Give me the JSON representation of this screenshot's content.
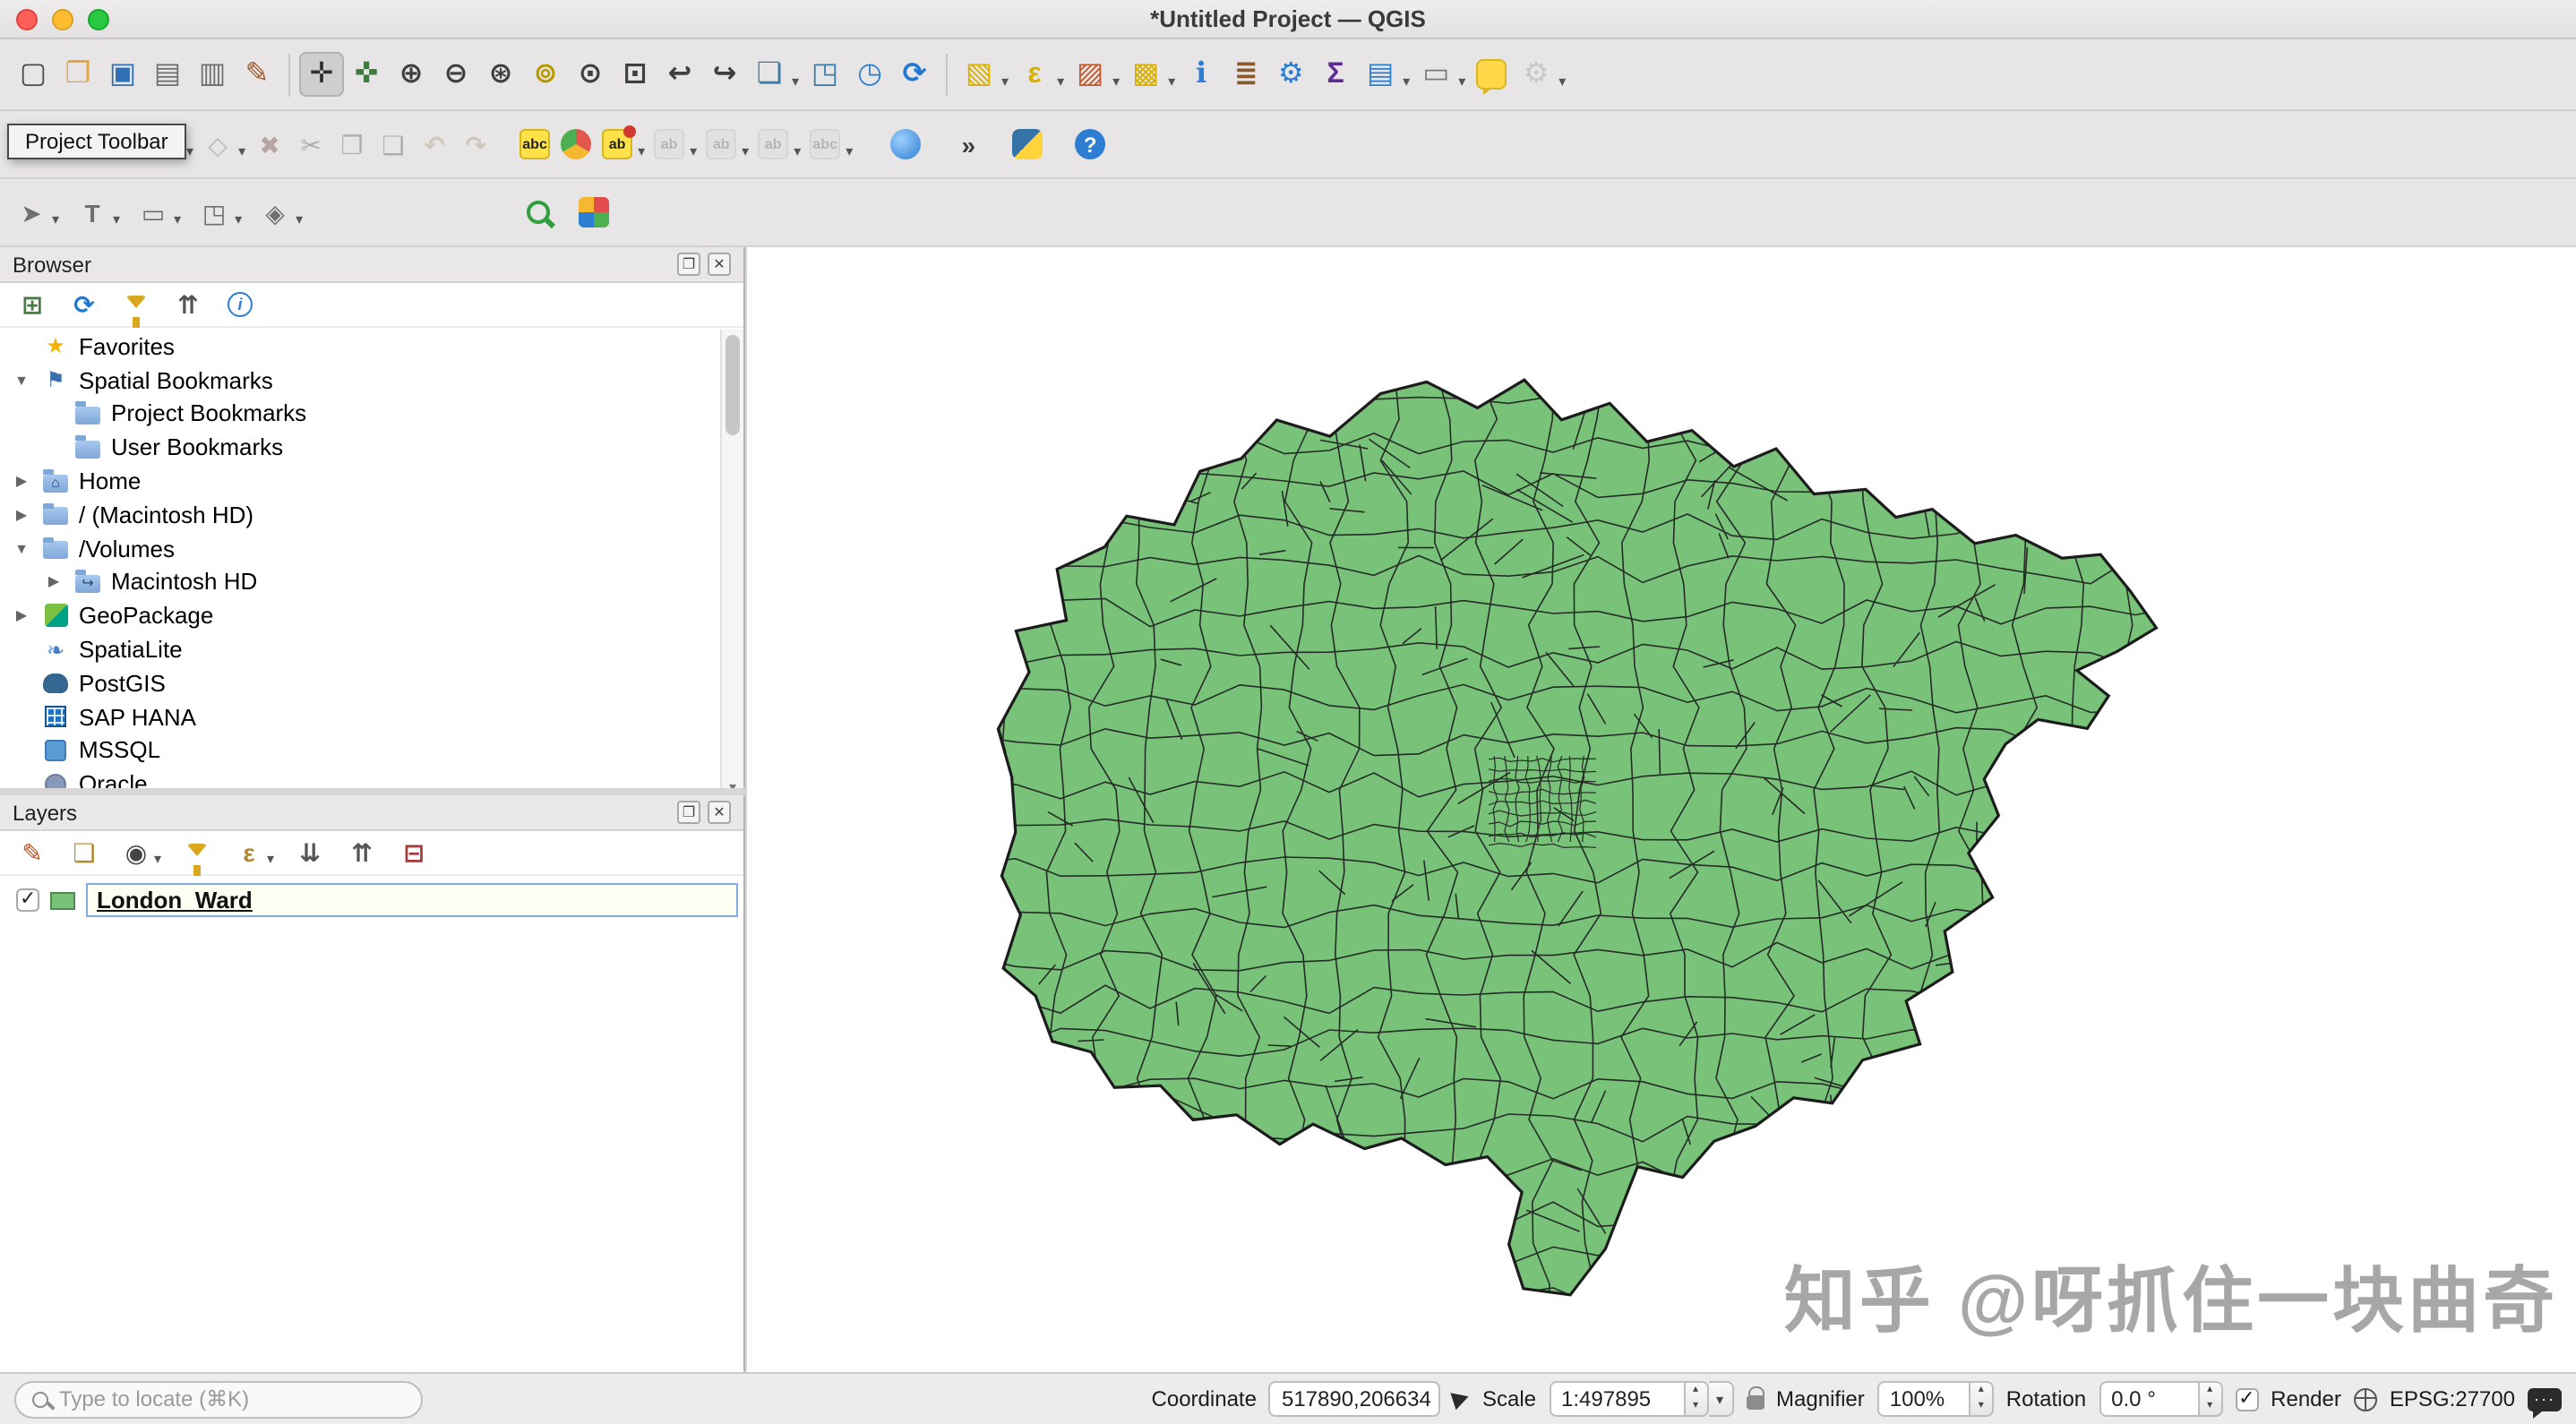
{
  "window": {
    "title": "*Untitled Project — QGIS"
  },
  "tooltip": {
    "text": "Project Toolbar"
  },
  "panel_buttons": {
    "float": "❐",
    "close": "✕"
  },
  "toolbar_row1": [
    {
      "name": "new-project",
      "glyph": "▢",
      "color": "#4a4a4a"
    },
    {
      "name": "open-project",
      "glyph": "❐",
      "color": "#e8a33d"
    },
    {
      "name": "save-project",
      "glyph": "▣",
      "color": "#2f6fb3"
    },
    {
      "name": "new-print-layout",
      "glyph": "▤",
      "color": "#6f6f6f"
    },
    {
      "name": "show-layout-manager",
      "glyph": "▥",
      "color": "#6f6f6f"
    },
    {
      "name": "style-manager",
      "glyph": "✎",
      "color": "#a05a2c"
    },
    {
      "sep": true
    },
    {
      "name": "pan-map",
      "glyph": "✛",
      "color": "#2f2f2f",
      "pressed": true
    },
    {
      "name": "pan-to-selection",
      "glyph": "✜",
      "color": "#3d7a3d"
    },
    {
      "name": "zoom-in",
      "glyph": "⊕",
      "color": "#3f3f3f"
    },
    {
      "name": "zoom-out",
      "glyph": "⊖",
      "color": "#3f3f3f"
    },
    {
      "name": "zoom-full-extent",
      "glyph": "⊛",
      "color": "#3f3f3f"
    },
    {
      "name": "zoom-to-selection",
      "glyph": "⊚",
      "color": "#b59a00"
    },
    {
      "name": "zoom-to-layer",
      "glyph": "⊙",
      "color": "#3f3f3f"
    },
    {
      "name": "zoom-native",
      "glyph": "⊡",
      "color": "#3f3f3f"
    },
    {
      "name": "zoom-last",
      "glyph": "↩",
      "color": "#3f3f3f"
    },
    {
      "name": "zoom-next",
      "glyph": "↪",
      "color": "#3f3f3f"
    },
    {
      "name": "new-map-view",
      "glyph": "❏",
      "color": "#3a7ca5",
      "dropdown": true
    },
    {
      "name": "new-3d-map-view",
      "glyph": "◳",
      "color": "#3a7ca5"
    },
    {
      "name": "temporal-controller",
      "glyph": "◷",
      "color": "#2d7dd2"
    },
    {
      "name": "refresh-map",
      "glyph": "⟳",
      "color": "#1f78d1"
    },
    {
      "sep": true
    },
    {
      "name": "select-features",
      "glyph": "▧",
      "color": "#d8b000",
      "dropdown": true
    },
    {
      "name": "select-by-expression",
      "glyph": "ε",
      "color": "#d8b000",
      "dropdown": true
    },
    {
      "name": "deselect-features",
      "glyph": "▨",
      "color": "#c2572a",
      "dropdown": true
    },
    {
      "name": "select-by-value",
      "glyph": "▩",
      "color": "#d8b000",
      "dropdown": true
    },
    {
      "name": "identify-features",
      "glyph": "ℹ",
      "color": "#2d7dd2"
    },
    {
      "name": "field-calculator",
      "glyph": "≣",
      "color": "#8a5a2c"
    },
    {
      "name": "processing-toolbox",
      "glyph": "⚙",
      "color": "#2d7dd2"
    },
    {
      "name": "statistical-summary",
      "glyph": "Σ",
      "color": "#5c2d91"
    },
    {
      "name": "attributes-panel",
      "glyph": "▤",
      "color": "#2d7dd2",
      "dropdown": true
    },
    {
      "name": "measure",
      "glyph": "▭",
      "color": "#7a7a7a",
      "dropdown": true
    },
    {
      "name": "map-tips",
      "cls": "bubble-y"
    },
    {
      "name": "annotation-tools",
      "glyph": "⚙",
      "color": "#9a9a9a",
      "dropdown": true,
      "enabled": false
    }
  ],
  "toolbar_row2": [
    {
      "name": "current-edits",
      "glyph": "✎",
      "color": "#6f6f6f",
      "dropdown": true,
      "enabled": false
    },
    {
      "name": "toggle-editing",
      "glyph": "✏",
      "color": "#b08830",
      "enabled": false
    },
    {
      "name": "save-layer-edits",
      "glyph": "▣",
      "color": "#6f6f6f",
      "enabled": false
    },
    {
      "name": "add-feature",
      "glyph": "◉",
      "color": "#3d7a3d",
      "dropdown": true,
      "enabled": false
    },
    {
      "name": "vertex-tool",
      "glyph": "◇",
      "color": "#6f6f6f",
      "dropdown": true,
      "enabled": false
    },
    {
      "name": "delete-selected",
      "glyph": "✖",
      "color": "#b03030",
      "enabled": false
    },
    {
      "name": "cut-features",
      "glyph": "✂",
      "color": "#555555",
      "enabled": false
    },
    {
      "name": "copy-features",
      "glyph": "❐",
      "color": "#555555",
      "enabled": false
    },
    {
      "name": "paste-features",
      "glyph": "❑",
      "color": "#555555",
      "enabled": false
    },
    {
      "name": "undo",
      "glyph": "↶",
      "color": "#c79a1e",
      "enabled": false
    },
    {
      "name": "redo",
      "glyph": "↷",
      "color": "#c79a1e",
      "enabled": false
    },
    {
      "gap": 10
    },
    {
      "name": "layer-labeling",
      "cls": "abc",
      "text": "abc"
    },
    {
      "name": "layer-diagram",
      "cls": "pie"
    },
    {
      "name": "pin-labels",
      "cls": "abc-red",
      "text": "ab",
      "dropdown": true
    },
    {
      "name": "highlight-pinned-labels",
      "cls": "abc-gray",
      "text": "ab",
      "enabled": false,
      "dropdown": true
    },
    {
      "name": "move-label",
      "cls": "abc-gray",
      "text": "ab",
      "enabled": false,
      "dropdown": true
    },
    {
      "name": "rotate-label",
      "cls": "abc-gray",
      "text": "ab",
      "enabled": false,
      "dropdown": true
    },
    {
      "name": "change-label-properties",
      "cls": "abc-gray",
      "text": "abc",
      "enabled": false,
      "dropdown": true
    },
    {
      "gap": 16
    },
    {
      "name": "metasearch",
      "cls": "globe"
    },
    {
      "gap": 12
    },
    {
      "name": "toolbar-overflow",
      "glyph": "»",
      "color": "#3f3f3f"
    },
    {
      "gap": 10
    },
    {
      "name": "python-console",
      "cls": "python"
    },
    {
      "gap": 12
    },
    {
      "name": "help",
      "cls": "help",
      "text": "?"
    }
  ],
  "toolbar_row3": [
    {
      "name": "move-annotation",
      "glyph": "➤",
      "color": "#6f6f6f",
      "dropdown": true
    },
    {
      "gap": 5
    },
    {
      "name": "text-annotation",
      "glyph": "T",
      "color": "#6f6f6f",
      "dropdown": true
    },
    {
      "gap": 5
    },
    {
      "name": "form-annotation",
      "glyph": "▭",
      "color": "#6f6f6f",
      "dropdown": true
    },
    {
      "gap": 5
    },
    {
      "name": "html-annotation",
      "glyph": "◳",
      "color": "#6f6f6f",
      "dropdown": true
    },
    {
      "gap": 5
    },
    {
      "name": "svg-annotation",
      "glyph": "◈",
      "color": "#6f6f6f",
      "dropdown": true
    },
    {
      "gap": 118
    },
    {
      "name": "geosearch",
      "cls": "mag-green"
    },
    {
      "gap": 8
    },
    {
      "name": "quickmapservices",
      "cls": "qms"
    }
  ],
  "browser": {
    "title": "Browser",
    "toolbar": [
      {
        "name": "add-selected-layers",
        "glyph": "⊞",
        "color": "#4a7a4a"
      },
      {
        "name": "refresh-browser",
        "glyph": "⟳",
        "color": "#1f78d1"
      },
      {
        "name": "filter-browser",
        "cls": "funnel"
      },
      {
        "name": "collapse-all-browser",
        "glyph": "⇈",
        "color": "#555555"
      },
      {
        "name": "properties-widget",
        "cls": "info-circle",
        "text": "i"
      }
    ],
    "items": [
      {
        "label": "Favorites",
        "depth": 0,
        "arrow": null,
        "icon": "star"
      },
      {
        "label": "Spatial Bookmarks",
        "depth": 0,
        "arrow": "down",
        "icon": "bookmark"
      },
      {
        "label": "Project Bookmarks",
        "depth": 1,
        "arrow": null,
        "icon": "folder"
      },
      {
        "label": "User Bookmarks",
        "depth": 1,
        "arrow": null,
        "icon": "folder"
      },
      {
        "label": "Home",
        "depth": 0,
        "arrow": "right",
        "icon": "home"
      },
      {
        "label": "/ (Macintosh HD)",
        "depth": 0,
        "arrow": "right",
        "icon": "folder"
      },
      {
        "label": "/Volumes",
        "depth": 0,
        "arrow": "down",
        "icon": "folder"
      },
      {
        "label": "Macintosh HD",
        "depth": 1,
        "arrow": "right",
        "icon": "folder-link"
      },
      {
        "label": "GeoPackage",
        "depth": 0,
        "arrow": "right",
        "icon": "gpkg"
      },
      {
        "label": "SpatiaLite",
        "depth": 0,
        "arrow": null,
        "icon": "slite"
      },
      {
        "label": "PostGIS",
        "depth": 0,
        "arrow": null,
        "icon": "pg"
      },
      {
        "label": "SAP HANA",
        "depth": 0,
        "arrow": null,
        "icon": "hana"
      },
      {
        "label": "MSSQL",
        "depth": 0,
        "arrow": null,
        "icon": "mssql"
      },
      {
        "label": "Oracle",
        "depth": 0,
        "arrow": null,
        "icon": "oracle"
      }
    ]
  },
  "layers": {
    "title": "Layers",
    "toolbar": [
      {
        "name": "open-layer-styling",
        "glyph": "✎",
        "color": "#c05020"
      },
      {
        "name": "add-group",
        "glyph": "❏",
        "color": "#b08830"
      },
      {
        "name": "manage-map-themes",
        "glyph": "◉",
        "color": "#444444",
        "dropdown": true
      },
      {
        "name": "filter-legend",
        "cls": "funnel"
      },
      {
        "name": "filter-by-expression",
        "glyph": "ε",
        "color": "#b08830",
        "dropdown": true
      },
      {
        "name": "expand-all-layers",
        "glyph": "⇊",
        "color": "#555555"
      },
      {
        "name": "collapse-all-layers",
        "glyph": "⇈",
        "color": "#555555"
      },
      {
        "name": "remove-layer",
        "glyph": "⊟",
        "color": "#a33b3b"
      }
    ],
    "items": [
      {
        "label": "London_Ward",
        "checked": true,
        "swatch": "#78c27a",
        "selected": true
      }
    ]
  },
  "map": {
    "fill": "#78c27a",
    "stroke": "#1c1c1c",
    "watermark": "知乎 @呀抓住一块曲奇"
  },
  "statusbar": {
    "locate_placeholder": "Type to locate (⌘K)",
    "coordinate_label": "Coordinate",
    "coordinate_value": "517890,206634",
    "scale_label": "Scale",
    "scale_value": "1:497895",
    "magnifier_label": "Magnifier",
    "magnifier_value": "100%",
    "rotation_label": "Rotation",
    "rotation_value": "0.0 °",
    "render_label": "Render",
    "crs_label": "EPSG:27700"
  }
}
